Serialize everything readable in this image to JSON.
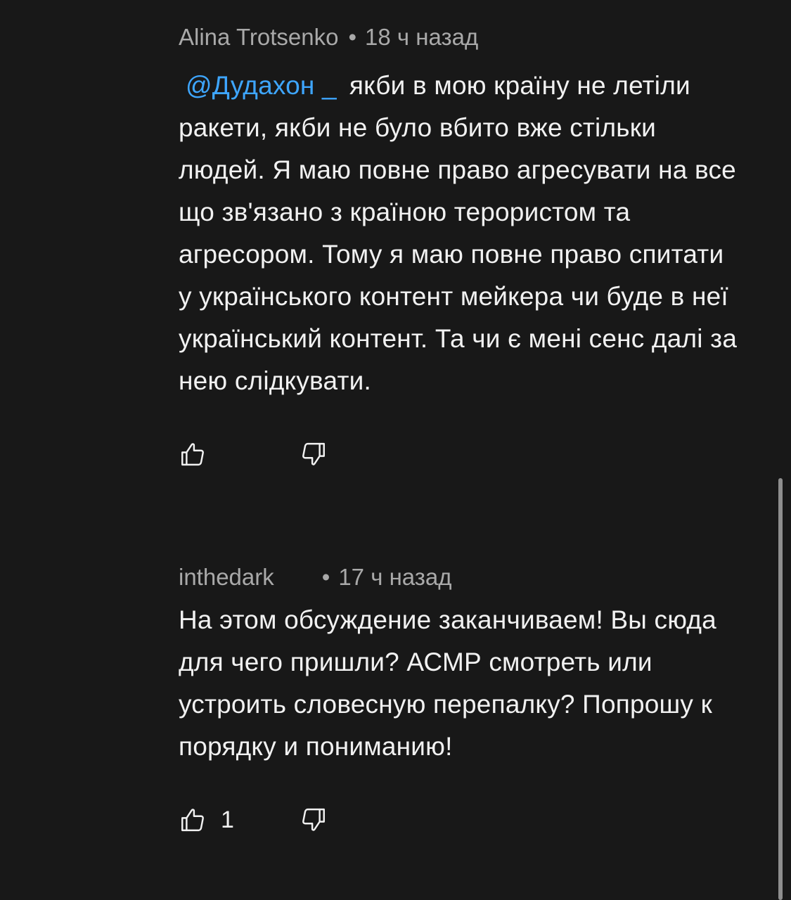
{
  "comments": [
    {
      "author": "Alina Trotsenko",
      "separator": "•",
      "time": "18 ч назад",
      "mention": "@Дудахон _",
      "text": "якби в мою країну не летіли ракети, якби не було вбито вже стільки людей. Я маю повне право агресувати на все що зв'язано з країною терористом та агресором. Тому я маю повне право спитати у українського контент мейкера чи буде в неї український контент. Та чи є мені сенс далі за нею слідкувати.",
      "likes": ""
    },
    {
      "author": "inthedark",
      "separator": "•",
      "time": "17 ч назад",
      "text": "На этом обсуждение заканчиваем! Вы сюда для чего пришли? АСМР смотреть или устроить словесную перепалку? Попрошу к порядку и пониманию!",
      "likes": "1"
    }
  ],
  "icons": {
    "like": "thumbs-up-icon",
    "dislike": "thumbs-down-icon"
  },
  "colors": {
    "background": "#181818",
    "text": "#f1f1f1",
    "meta": "#a9a9a9",
    "mention": "#3ea6ff"
  }
}
